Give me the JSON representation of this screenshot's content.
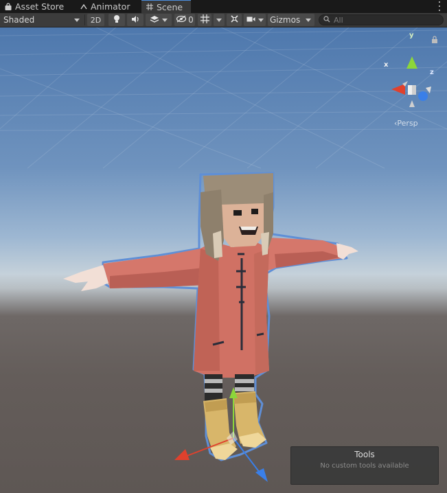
{
  "tabs": [
    {
      "label": "Asset Store",
      "icon": "shopping-bag-icon",
      "active": false
    },
    {
      "label": "Animator",
      "icon": "animator-icon",
      "active": false
    },
    {
      "label": "Scene",
      "icon": "scene-grid-icon",
      "active": true
    }
  ],
  "toolbar": {
    "draw_mode": "Shaded",
    "mode_2d": "2D",
    "hidden_count": "0",
    "gizmos": "Gizmos",
    "search_placeholder": "All"
  },
  "gizmo": {
    "x": "x",
    "y": "y",
    "z": "z",
    "projection": "Persp"
  },
  "tools_panel": {
    "title": "Tools",
    "message": "No custom tools available"
  },
  "colors": {
    "axis_x": "#e0412d",
    "axis_y": "#8cd63a",
    "axis_z": "#3a7fe8",
    "selection_outline": "#5f8fd6"
  }
}
